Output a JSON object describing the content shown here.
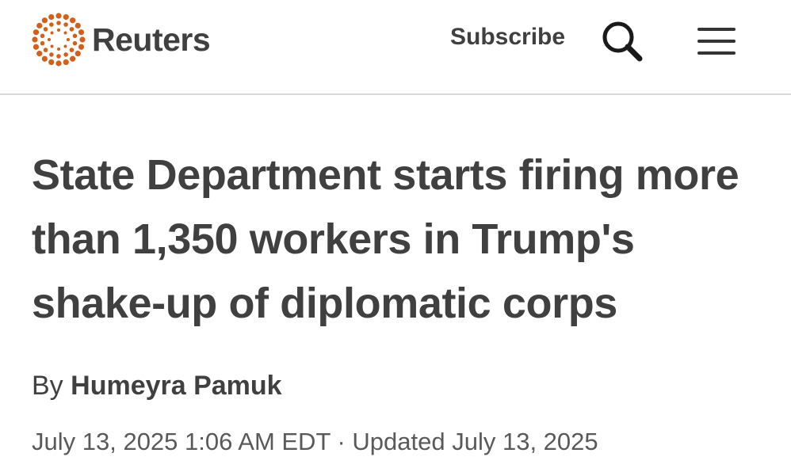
{
  "header": {
    "brand_name": "Reuters",
    "brand_color": "#d2601a",
    "subscribe_label": "Subscribe",
    "search_icon": "search-icon",
    "menu_icon": "hamburger-menu-icon"
  },
  "article": {
    "headline": "State Department starts firing more than 1,350 workers in Trump's shake-up of diplomatic corps",
    "byline_prefix": "By",
    "author": "Humeyra Pamuk",
    "published": "July 13, 2025 1:06 AM EDT",
    "separator": "·",
    "updated": "Updated July 13, 2025"
  }
}
